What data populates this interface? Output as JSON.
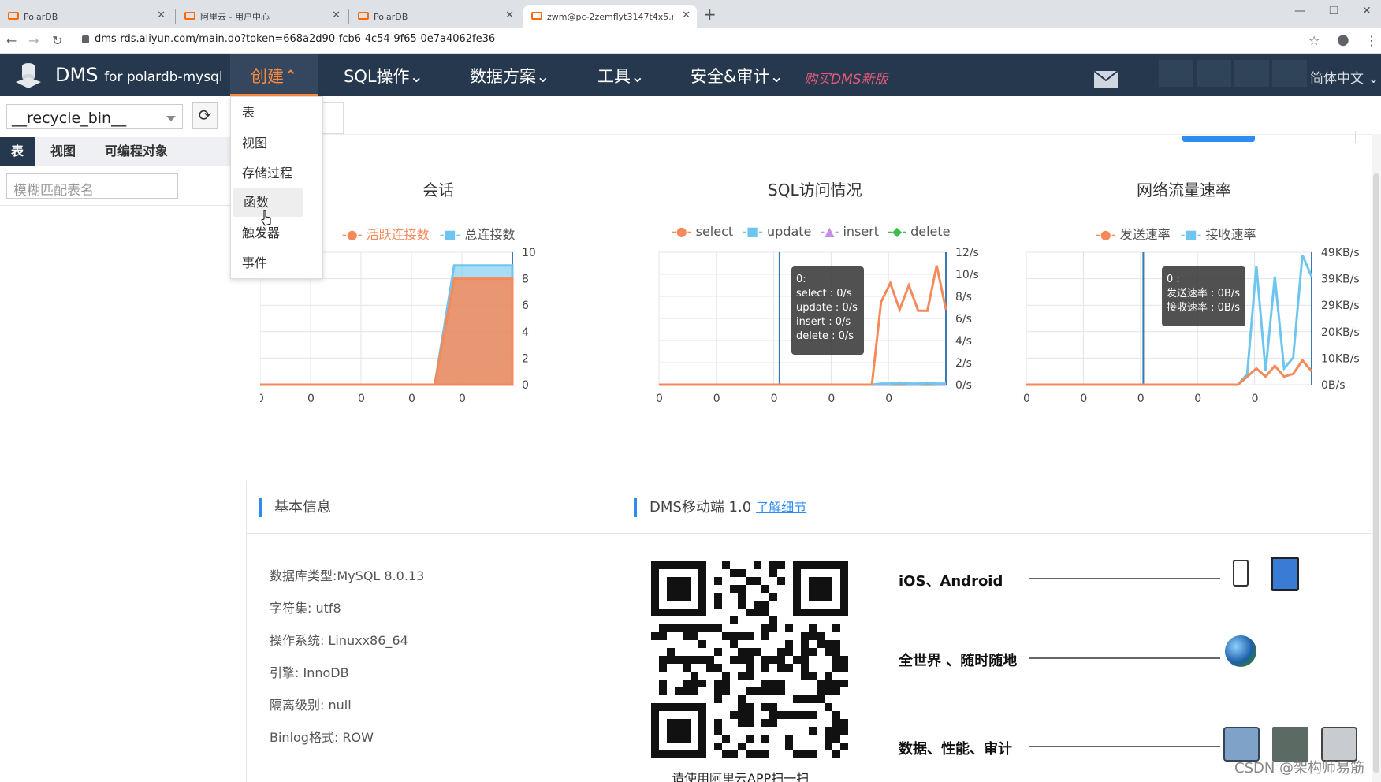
{
  "browser": {
    "tabs": [
      {
        "title": "PolarDB"
      },
      {
        "title": "阿里云 - 用户中心"
      },
      {
        "title": "PolarDB"
      },
      {
        "title": "zwm@pc-2zemflyt3147t4x5.r"
      }
    ],
    "url": "dms-rds.aliyun.com/main.do?token=668a2d90-fcb6-4c54-9f65-0e7a4062fe36"
  },
  "header": {
    "brand": "DMS",
    "brand_sub": "for polardb-mysql",
    "menus": [
      "创建⌃",
      "SQL操作⌄",
      "数据方案⌄",
      "工具⌄",
      "安全&审计⌄"
    ],
    "buy_link": "购买DMS新版",
    "language": "简体中文 ⌄"
  },
  "create_menu": {
    "items": [
      "表",
      "视图",
      "存储过程",
      "函数",
      "触发器",
      "事件"
    ],
    "hovered": "函数"
  },
  "left_panel": {
    "database": "__recycle_bin__",
    "tabs": [
      "表",
      "视图",
      "可编程对象"
    ],
    "filter_placeholder": "模糊匹配表名"
  },
  "chart_data": [
    {
      "type": "area",
      "title": "会话",
      "series": [
        {
          "name": "活跃连接数",
          "color": "#f48a5a",
          "values": [
            0,
            0,
            0,
            0,
            0,
            0,
            0,
            0,
            0,
            0,
            8,
            8,
            8,
            8
          ]
        },
        {
          "name": "总连接数",
          "color": "#6ec6ee",
          "values": [
            0,
            0,
            0,
            0,
            0,
            0,
            0,
            0,
            0,
            0,
            9,
            9,
            9,
            9
          ]
        }
      ],
      "x_tick_labels": [
        "0",
        "0",
        "0",
        "0",
        "0"
      ],
      "y_ticks": [
        "10",
        "8",
        "6",
        "4",
        "2",
        "0"
      ],
      "ylim": [
        0,
        10
      ]
    },
    {
      "type": "line",
      "title": "SQL访问情况",
      "series": [
        {
          "name": "select",
          "color": "#f48a5a",
          "values": [
            0,
            0,
            0,
            0,
            0,
            0,
            0,
            0,
            0,
            0,
            0,
            0,
            0,
            0,
            0,
            0,
            0,
            0,
            0,
            0,
            0,
            0,
            0,
            0,
            7.5,
            9.2,
            6.8,
            9.0,
            6.7,
            6.7,
            10.8,
            6.8
          ]
        },
        {
          "name": "update",
          "color": "#6ec6ee",
          "values": [
            0,
            0,
            0,
            0,
            0,
            0,
            0,
            0,
            0,
            0,
            0,
            0,
            0,
            0,
            0,
            0,
            0,
            0,
            0,
            0,
            0,
            0,
            0,
            0,
            0.1,
            0.1,
            0.2,
            0.1,
            0.1,
            0.2,
            0.1,
            0.1
          ]
        },
        {
          "name": "insert",
          "color": "#c98de4",
          "values": [
            0,
            0,
            0,
            0,
            0,
            0,
            0,
            0,
            0,
            0,
            0,
            0,
            0,
            0,
            0,
            0,
            0,
            0,
            0,
            0,
            0,
            0,
            0,
            0,
            0,
            0,
            0.1,
            0,
            0,
            0.1,
            0,
            0
          ]
        },
        {
          "name": "delete",
          "color": "#3cbf4a",
          "values": [
            0,
            0,
            0,
            0,
            0,
            0,
            0,
            0,
            0,
            0,
            0,
            0,
            0,
            0,
            0,
            0,
            0,
            0,
            0,
            0,
            0,
            0,
            0,
            0,
            0,
            0,
            0,
            0,
            0,
            0,
            0,
            0
          ]
        }
      ],
      "x_tick_labels": [
        "0",
        "0",
        "0",
        "0",
        "0"
      ],
      "y_ticks": [
        "12/s",
        "10/s",
        "8/s",
        "6/s",
        "4/s",
        "2/s",
        "0/s"
      ],
      "ylim": [
        0,
        12
      ],
      "tooltip": [
        "0:",
        "select : 0/s",
        "update : 0/s",
        "insert : 0/s",
        "delete : 0/s"
      ]
    },
    {
      "type": "line",
      "title": "网络流量速率",
      "series": [
        {
          "name": "发送速率",
          "color": "#f48a5a",
          "values": [
            0,
            0,
            0,
            0,
            0,
            0,
            0,
            0,
            0,
            0,
            0,
            0,
            0,
            0,
            0,
            0,
            0,
            0,
            0,
            0,
            0,
            0,
            0,
            0,
            3,
            6,
            3,
            7,
            3,
            4,
            9,
            5
          ]
        },
        {
          "name": "接收速率",
          "color": "#6ec6ee",
          "values": [
            0,
            0,
            0,
            0,
            0,
            0,
            0,
            0,
            0,
            0,
            0,
            0,
            0,
            0,
            0,
            0,
            0,
            0,
            0,
            0,
            0,
            0,
            0,
            0,
            4,
            44,
            5,
            40,
            6,
            10,
            48,
            40
          ]
        }
      ],
      "x_tick_labels": [
        "0",
        "0",
        "0",
        "0",
        "0"
      ],
      "y_ticks": [
        "49KB/s",
        "39KB/s",
        "29KB/s",
        "20KB/s",
        "10KB/s",
        "0B/s"
      ],
      "ylim": [
        0,
        49
      ],
      "tooltip": [
        "0 :",
        "发送速率 : 0B/s",
        "接收速率 : 0B/s"
      ]
    }
  ],
  "basic_info": {
    "title": "基本信息",
    "rows": [
      "数据库类型:MySQL 8.0.13",
      "字符集: utf8",
      "操作系统: Linuxx86_64",
      "引擎:  InnoDB",
      "隔离级别:  null",
      "Binlog格式:  ROW"
    ]
  },
  "mobile": {
    "title": "DMS移动端 1.0",
    "link": "了解细节",
    "qr_caption": "请使用阿里云APP扫一扫",
    "features": [
      "iOS、Android",
      "全世界 、随时随地",
      "数据、性能、审计"
    ]
  },
  "watermark": "CSDN @架构师易筋"
}
